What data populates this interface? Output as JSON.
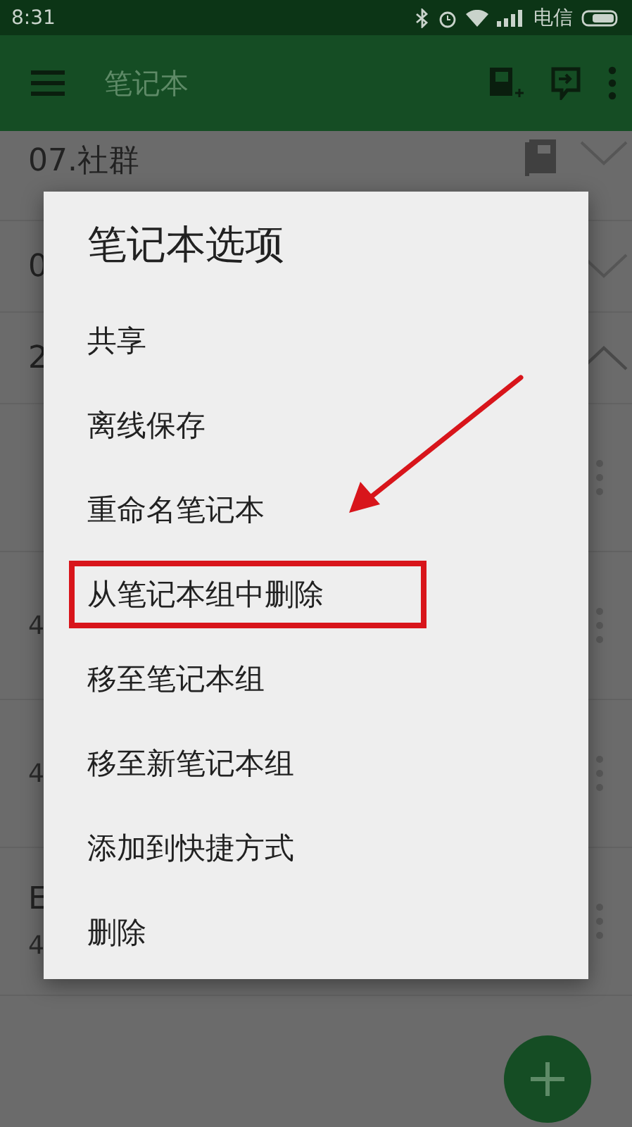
{
  "status_bar": {
    "time": "8:31",
    "carrier": "电信"
  },
  "app_bar": {
    "title": "笔记本"
  },
  "notebooks": [
    {
      "name": "07.社群",
      "expanded": false,
      "icon": true
    },
    {
      "name": "0",
      "expanded": false,
      "icon": false
    },
    {
      "name": "2",
      "expanded": true,
      "icon": false
    }
  ],
  "notes": [
    {
      "kind": "note"
    },
    {
      "kind": "note",
      "count": "4"
    },
    {
      "kind": "note",
      "count": "4"
    },
    {
      "kind": "note",
      "title": "E",
      "count": "4"
    }
  ],
  "dialog": {
    "title": "笔记本选项",
    "items": [
      {
        "label": "共享",
        "highlighted": false
      },
      {
        "label": "离线保存",
        "highlighted": false
      },
      {
        "label": "重命名笔记本",
        "highlighted": false
      },
      {
        "label": "从笔记本组中删除",
        "highlighted": true
      },
      {
        "label": "移至笔记本组",
        "highlighted": false
      },
      {
        "label": "移至新笔记本组",
        "highlighted": false
      },
      {
        "label": "添加到快捷方式",
        "highlighted": false
      },
      {
        "label": "删除",
        "highlighted": false
      }
    ]
  }
}
